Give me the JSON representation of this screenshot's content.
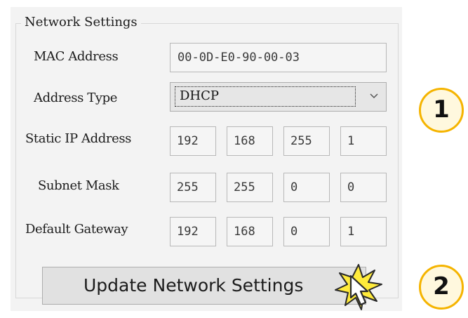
{
  "network_settings": {
    "title": "Network Settings",
    "mac_label": "MAC Address",
    "mac_value": "00-0D-E0-90-00-03",
    "address_type_label": "Address Type",
    "address_type_value": "DHCP",
    "static_ip_label": "Static IP Address",
    "static_ip": [
      "192",
      "168",
      "255",
      "1"
    ],
    "subnet_label": "Subnet Mask",
    "subnet": [
      "255",
      "255",
      "0",
      "0"
    ],
    "gateway_label": "Default Gateway",
    "gateway": [
      "192",
      "168",
      "0",
      "1"
    ],
    "update_button_label": "Update Network Settings"
  },
  "steps": [
    "1",
    "2"
  ],
  "colors": {
    "step_circle_border": "#f5b400",
    "step_circle_fill": "#fff8de",
    "click_burst": "#ffeb3b"
  },
  "icons": {
    "dropdown": "chevron-down-icon",
    "click": "click-burst-icon",
    "cursor": "pointer-hand-icon"
  }
}
